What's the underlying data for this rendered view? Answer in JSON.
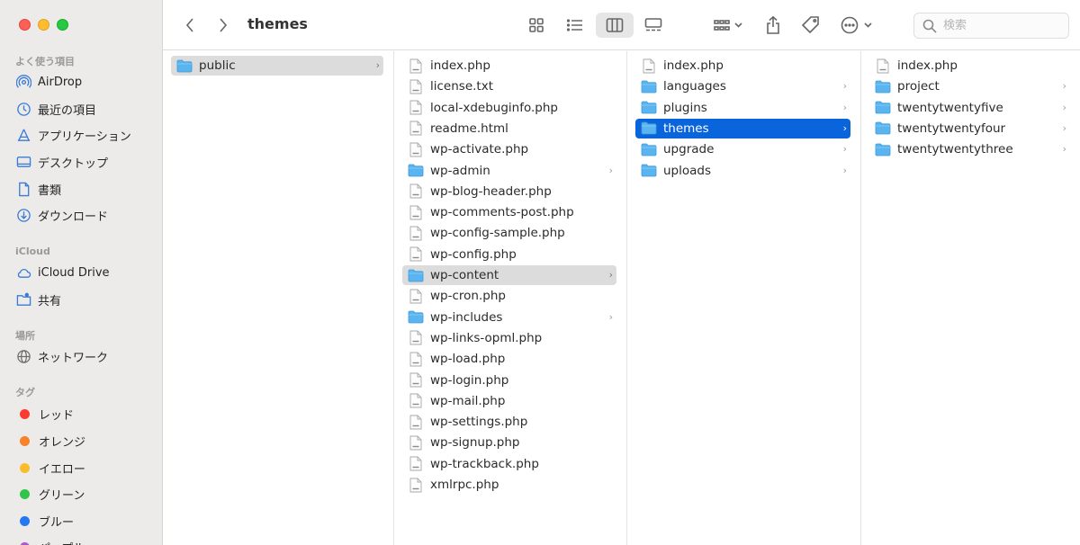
{
  "window": {
    "title": "themes"
  },
  "sidebar": {
    "sections": [
      {
        "label": "よく使う項目"
      },
      {
        "label": "iCloud"
      },
      {
        "label": "場所"
      },
      {
        "label": "タグ"
      }
    ],
    "favorites": [
      {
        "label": "AirDrop",
        "icon": "airdrop-icon"
      },
      {
        "label": "最近の項目",
        "icon": "clock-icon"
      },
      {
        "label": "アプリケーション",
        "icon": "applications-icon"
      },
      {
        "label": "デスクトップ",
        "icon": "desktop-icon"
      },
      {
        "label": "書類",
        "icon": "document-icon"
      },
      {
        "label": "ダウンロード",
        "icon": "download-icon"
      }
    ],
    "icloud": [
      {
        "label": "iCloud Drive",
        "icon": "cloud-icon"
      },
      {
        "label": "共有",
        "icon": "shared-folder-icon"
      }
    ],
    "locations": [
      {
        "label": "ネットワーク",
        "icon": "network-icon"
      }
    ],
    "tags": [
      {
        "label": "レッド",
        "color": "#fe3b30"
      },
      {
        "label": "オレンジ",
        "color": "#f6832a"
      },
      {
        "label": "イエロー",
        "color": "#f9bd2c"
      },
      {
        "label": "グリーン",
        "color": "#31c448"
      },
      {
        "label": "ブルー",
        "color": "#2577f2"
      },
      {
        "label": "パープル",
        "color": "#a85ad6"
      }
    ]
  },
  "toolbar": {
    "back_icon": "chevron-left-icon",
    "forward_icon": "chevron-right-icon",
    "view_modes": [
      "icon-view-icon",
      "list-view-icon",
      "column-view-icon",
      "gallery-view-icon"
    ],
    "active_view": "column-view-icon",
    "search": {
      "placeholder": "検索",
      "value": ""
    }
  },
  "columns": [
    {
      "items": [
        {
          "name": "public",
          "kind": "folder",
          "has_children": true,
          "selected": "gray"
        }
      ]
    },
    {
      "items": [
        {
          "name": "index.php",
          "kind": "file"
        },
        {
          "name": "license.txt",
          "kind": "file"
        },
        {
          "name": "local-xdebuginfo.php",
          "kind": "file"
        },
        {
          "name": "readme.html",
          "kind": "file"
        },
        {
          "name": "wp-activate.php",
          "kind": "file"
        },
        {
          "name": "wp-admin",
          "kind": "folder",
          "has_children": true
        },
        {
          "name": "wp-blog-header.php",
          "kind": "file"
        },
        {
          "name": "wp-comments-post.php",
          "kind": "file"
        },
        {
          "name": "wp-config-sample.php",
          "kind": "file"
        },
        {
          "name": "wp-config.php",
          "kind": "file"
        },
        {
          "name": "wp-content",
          "kind": "folder",
          "has_children": true,
          "selected": "gray"
        },
        {
          "name": "wp-cron.php",
          "kind": "file"
        },
        {
          "name": "wp-includes",
          "kind": "folder",
          "has_children": true
        },
        {
          "name": "wp-links-opml.php",
          "kind": "file"
        },
        {
          "name": "wp-load.php",
          "kind": "file"
        },
        {
          "name": "wp-login.php",
          "kind": "file"
        },
        {
          "name": "wp-mail.php",
          "kind": "file"
        },
        {
          "name": "wp-settings.php",
          "kind": "file"
        },
        {
          "name": "wp-signup.php",
          "kind": "file"
        },
        {
          "name": "wp-trackback.php",
          "kind": "file"
        },
        {
          "name": "xmlrpc.php",
          "kind": "file"
        }
      ]
    },
    {
      "items": [
        {
          "name": "index.php",
          "kind": "file"
        },
        {
          "name": "languages",
          "kind": "folder",
          "has_children": true
        },
        {
          "name": "plugins",
          "kind": "folder",
          "has_children": true
        },
        {
          "name": "themes",
          "kind": "folder",
          "has_children": true,
          "selected": "blue"
        },
        {
          "name": "upgrade",
          "kind": "folder",
          "has_children": true
        },
        {
          "name": "uploads",
          "kind": "folder",
          "has_children": true
        }
      ]
    },
    {
      "items": [
        {
          "name": "index.php",
          "kind": "file"
        },
        {
          "name": "project",
          "kind": "folder",
          "has_children": true
        },
        {
          "name": "twentytwentyfive",
          "kind": "folder",
          "has_children": true
        },
        {
          "name": "twentytwentyfour",
          "kind": "folder",
          "has_children": true
        },
        {
          "name": "twentytwentythree",
          "kind": "folder",
          "has_children": true
        }
      ]
    }
  ],
  "colors": {
    "accent": "#0a64dc",
    "folder": "#5ab4f0",
    "selection_gray": "#dcdcdc"
  }
}
